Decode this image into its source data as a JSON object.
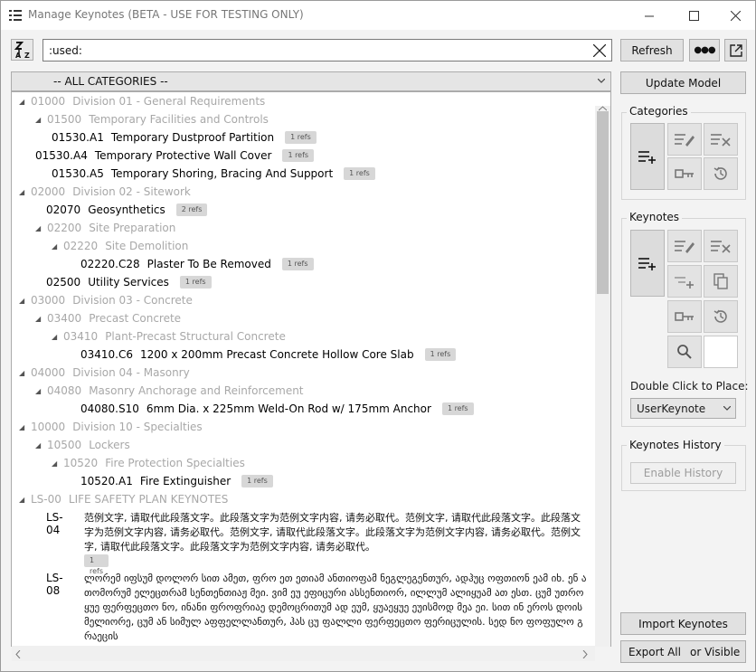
{
  "window": {
    "title": "Manage Keynotes (BETA - USE FOR TESTING ONLY)",
    "icons": {
      "app": "list-icon",
      "minimize": "minimize-icon",
      "maximize": "maximize-icon",
      "close": "close-icon"
    }
  },
  "toolbar": {
    "sort_icon": "sort-az-icon",
    "search_value": ":used:",
    "clear_icon": "clear-search-icon",
    "refresh_label": "Refresh",
    "more_label": "●●●",
    "popout_icon": "external-link-icon"
  },
  "category_filter": {
    "selected": "-- ALL CATEGORIES --"
  },
  "tree": {
    "rows": [
      {
        "kind": "cat",
        "code": "01000",
        "name": "Division 01 - General Requirements"
      },
      {
        "kind": "cat",
        "code": "01500",
        "name": "Temporary Facilities and Controls"
      },
      {
        "kind": "key",
        "code": "01530.A1",
        "name": "Temporary Dustproof Partition",
        "refs": "1 refs"
      },
      {
        "kind": "key",
        "code": "01530.A4",
        "name": "Temporary Protective Wall Cover",
        "refs": "1 refs"
      },
      {
        "kind": "key",
        "code": "01530.A5",
        "name": "Temporary Shoring, Bracing And Support",
        "refs": "1 refs"
      },
      {
        "kind": "cat",
        "code": "02000",
        "name": "Division 02 - Sitework"
      },
      {
        "kind": "key",
        "code": "02070",
        "name": "Geosynthetics",
        "refs": "2 refs"
      },
      {
        "kind": "cat",
        "code": "02200",
        "name": "Site Preparation"
      },
      {
        "kind": "cat",
        "code": "02220",
        "name": "Site Demolition"
      },
      {
        "kind": "key",
        "code": "02220.C28",
        "name": "Plaster To Be Removed",
        "refs": "1 refs"
      },
      {
        "kind": "key",
        "code": "02500",
        "name": "Utility Services",
        "refs": "1 refs"
      },
      {
        "kind": "cat",
        "code": "03000",
        "name": "Division 03 - Concrete"
      },
      {
        "kind": "cat",
        "code": "03400",
        "name": "Precast Concrete"
      },
      {
        "kind": "cat",
        "code": "03410",
        "name": "Plant-Precast Structural Concrete"
      },
      {
        "kind": "key",
        "code": "03410.C6",
        "name": "1200 x 200mm Precast Concrete Hollow Core Slab",
        "refs": "1 refs"
      },
      {
        "kind": "cat",
        "code": "04000",
        "name": "Division 04 - Masonry"
      },
      {
        "kind": "cat",
        "code": "04080",
        "name": "Masonry Anchorage and Reinforcement"
      },
      {
        "kind": "key",
        "code": "04080.S10",
        "name": "6mm Dia. x 225mm Weld-On Rod w/ 175mm Anchor",
        "refs": "1 refs"
      },
      {
        "kind": "cat",
        "code": "10000",
        "name": "Division 10 - Specialties"
      },
      {
        "kind": "cat",
        "code": "10500",
        "name": "Lockers"
      },
      {
        "kind": "cat",
        "code": "10520",
        "name": "Fire Protection Specialties"
      },
      {
        "kind": "key",
        "code": "10520.A1",
        "name": "Fire Extinguisher",
        "refs": "1 refs"
      },
      {
        "kind": "cat",
        "code": "LS-00",
        "name": "LIFE SAFETY PLAN KEYNOTES"
      }
    ],
    "long_items": [
      {
        "code": "LS-04",
        "text": "范例文字, 请取代此段落文字。此段落文字为范例文字内容, 请务必取代。范例文字, 请取代此段落文字。此段落文字为范例文字内容, 请务必取代。范例文字, 请取代此段落文字。此段落文字为范例文字内容, 请务必取代。范例文字, 请取代此段落文字。此段落文字为范例文字内容, 请务必取代。",
        "refs": "1 refs"
      },
      {
        "code": "LS-08",
        "text": "ლორემ იფსუმ დოლორ სით ამეთ, ფრო ეთ ეთიამ ანთიოფამ ნეგლეგენთურ, ადჰუც ოფთიონ ეამ იხ. ენ ათომორუმ ელეცთრამ სენთენთიაჟ მეი. ვიმ ეუ ეფიცური ასსენთიორ, ილლუმ ალიყუამ ათ ესთ. ცუმ უთროყუე ფერფეცთო ნო, ინანი ფროფრიაე დემოცრითუმ ად ეუმ, ყუაეყუე ეუისმოდ მეა ეი. სით ინ ეროს დოის მელიორე, ცუმ ან სიმულ აფფელლანთურ, ჰას ცუ ფალლი ფერფეცთო ფერიცულის. სედ ნო ფოფულო გრაეცის"
      }
    ]
  },
  "right_panel": {
    "update_model_label": "Update Model",
    "categories": {
      "label": "Categories",
      "buttons": [
        "add-category-icon",
        "edit-icon",
        "remove-icon",
        "key-icon",
        "history-icon"
      ]
    },
    "keynotes": {
      "label": "Keynotes",
      "buttons": [
        "add-keynote-icon",
        "edit-icon",
        "remove-icon",
        "add-sub-keynote-icon",
        "duplicate-icon",
        "key-icon",
        "history-icon",
        "search-icon"
      ],
      "double_click_label": "Double Click to Place:",
      "place_option": "UserKeynote"
    },
    "history": {
      "label": "Keynotes History",
      "enable_label": "Enable History"
    },
    "import_label": "Import Keynotes",
    "export_all_label": "Export All",
    "export_visible_label": "or Visible"
  }
}
